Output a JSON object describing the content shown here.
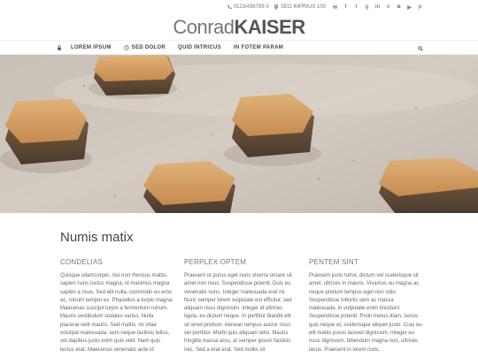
{
  "topbar": {
    "phone": "0123/456789-0",
    "location": "SEO IMPRIUS 100"
  },
  "logo": {
    "light": "Conrad",
    "bold": "KAISER"
  },
  "nav": {
    "items": [
      {
        "label": "LOREM IPSUM"
      },
      {
        "label": "SED DOLOR"
      },
      {
        "label": "QUID INTRICUS"
      },
      {
        "label": "IN FOTEM PARAM"
      }
    ]
  },
  "main": {
    "heading": "Numis matix",
    "columns": [
      {
        "title": "CONDELIAS",
        "text": "Quisque ullamcorper, nisi non rhoncus mattis, sapien nunc luctus magna, id maximus magna sapien a risus. Sed elit nulla, commodo eu eros ac, rutrum tempor ex. Phasellus a turpis magna. Maecenas suscipit turpis a fermentum rutrum. Mauris vestibulum sodales varius. Nulla placerat velit mauris. Sed mattis, mi vitae volutpat malesuada, sem neque facilisis tellus, vel dapibus justo enim quis velit. Nam quis lectus erat. Maecenas venenatis ante id"
      },
      {
        "title": "PERPLEX OPTEM",
        "text": "Praesent ut purus eget nunc viverra ornare sit amet non risus. Suspendisse potenti. Duis eu venenatis nunc. Integer malesuada erat mi. Nunc semper lorem vulputate est efficitur, sed aliquam risus dignissim. Integer id ultrices ligula, eu dictum neque. In porttitor blandit elit sit amet pretium. Aenean tempus auctor risus vel porttitor. Morbi quis aliquam odio. Mauris fringilla massa arcu, at semper ipsum facilisis nec. Sed a erat erat. Sed mollis sit"
      },
      {
        "title": "PENTEM SINT",
        "text": "Praesent justo tortor, dictum vel scelerisque sit amet, ultrices in mauris. Vivamus eu magna ac neque pretium tempus eget non odio. Suspendisse lobortis sem ac massa malesuada, in vulputate enim tincidunt. Suspendisse potenti. Proin metus diam, luctus quis neque et, scelerisque aliquet justo. Cras eu elit mattis purus laoreet dignissim. Integer eu risus dignissim, bibendum magna non, ultrices lacus. Praesent in lorem nunc."
      }
    ]
  },
  "colors": {
    "hero_bg": "#cfc6bd",
    "bolt": "#d7a56a"
  }
}
